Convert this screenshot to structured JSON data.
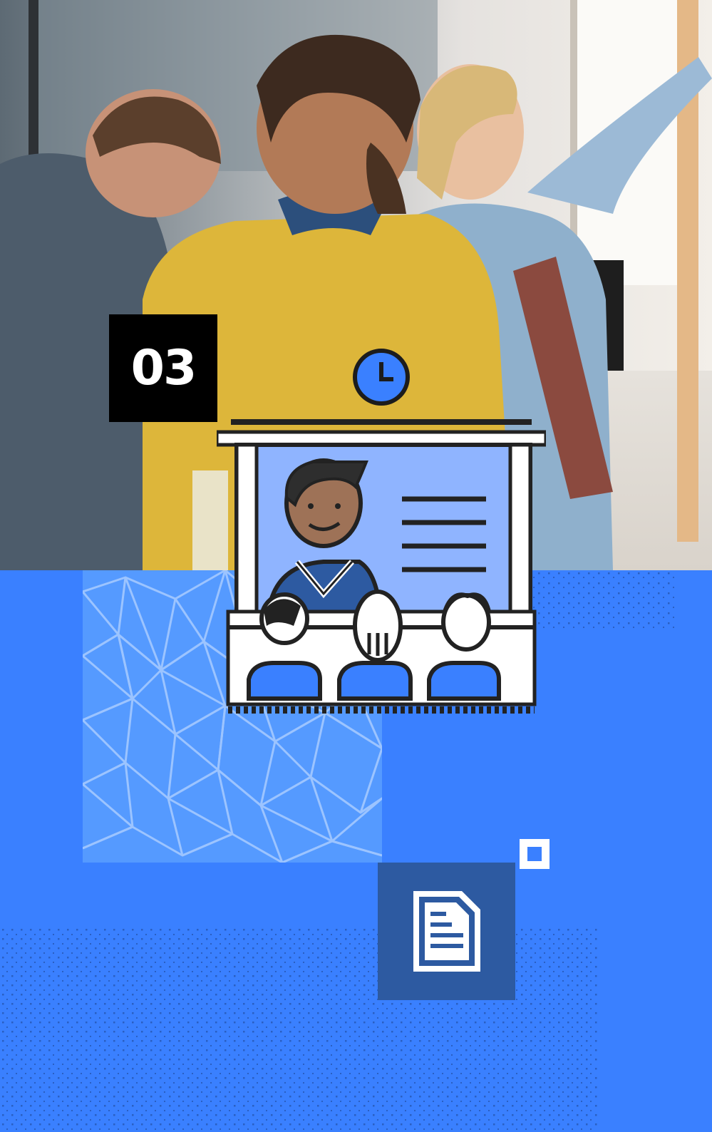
{
  "badge": {
    "number": "03"
  },
  "icons": {
    "clock": "clock-icon",
    "presenter": "presentation-screen-icon",
    "document": "document-icon",
    "small_square": "square-outline-icon"
  },
  "colors": {
    "primary_blue": "#3a80ff",
    "light_blue": "#8fb4ff",
    "dark_blue": "#2d5aa1",
    "pattern_blue": "#559aff",
    "black": "#000000",
    "white": "#ffffff"
  }
}
